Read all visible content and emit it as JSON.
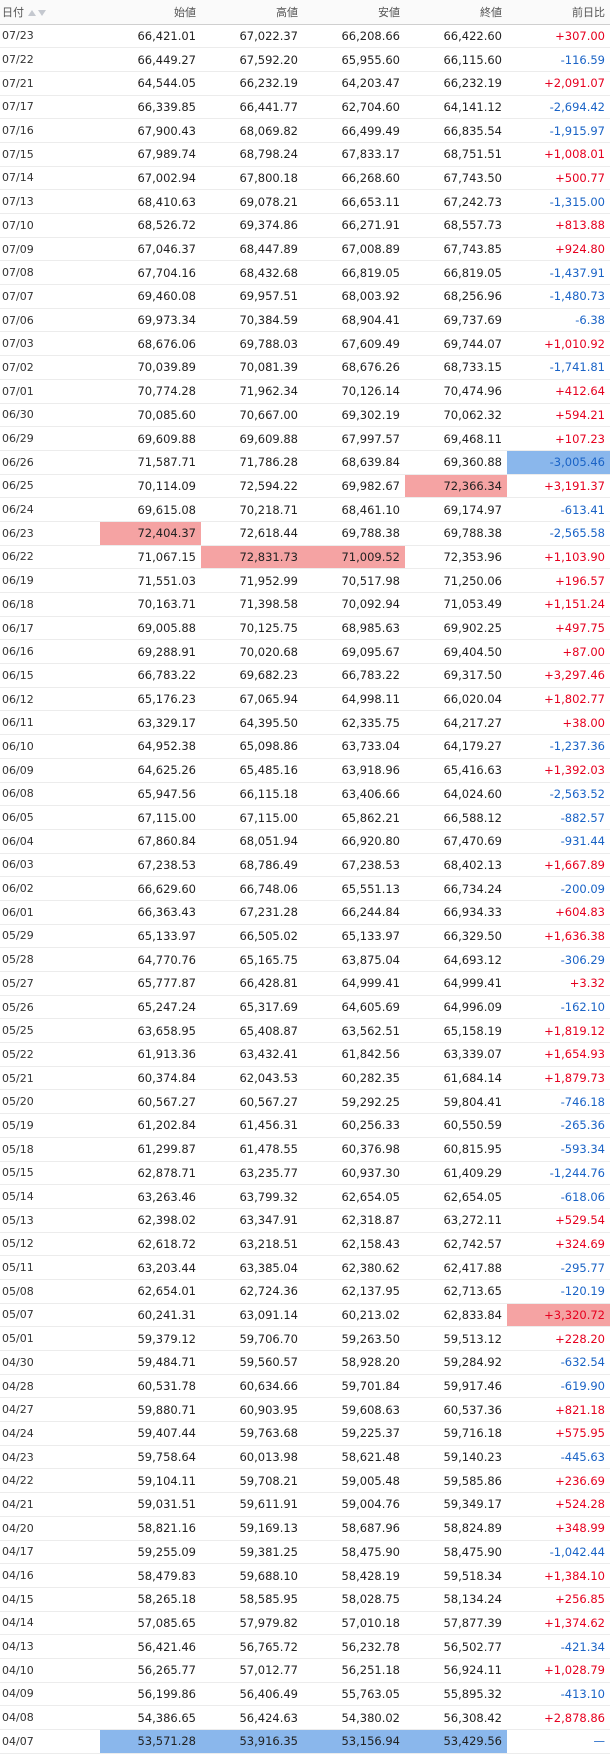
{
  "headers": {
    "date": "日付",
    "open": "始値",
    "high": "高値",
    "low": "安値",
    "close": "終値",
    "change": "前日比"
  },
  "colors": {
    "up": "#e6001f",
    "down": "#1a63c6",
    "highlight_high": "#f5a3a3",
    "highlight_low": "#8ab7ec"
  },
  "rows": [
    {
      "date": "07/23",
      "open": "66,421.01",
      "high": "67,022.37",
      "low": "66,208.66",
      "close": "66,422.60",
      "change": "+307.00"
    },
    {
      "date": "07/22",
      "open": "66,449.27",
      "high": "67,592.20",
      "low": "65,955.60",
      "close": "66,115.60",
      "change": "-116.59"
    },
    {
      "date": "07/21",
      "open": "64,544.05",
      "high": "66,232.19",
      "low": "64,203.47",
      "close": "66,232.19",
      "change": "+2,091.07"
    },
    {
      "date": "07/17",
      "open": "66,339.85",
      "high": "66,441.77",
      "low": "62,704.60",
      "close": "64,141.12",
      "change": "-2,694.42"
    },
    {
      "date": "07/16",
      "open": "67,900.43",
      "high": "68,069.82",
      "low": "66,499.49",
      "close": "66,835.54",
      "change": "-1,915.97"
    },
    {
      "date": "07/15",
      "open": "67,989.74",
      "high": "68,798.24",
      "low": "67,833.17",
      "close": "68,751.51",
      "change": "+1,008.01"
    },
    {
      "date": "07/14",
      "open": "67,002.94",
      "high": "67,800.18",
      "low": "66,268.60",
      "close": "67,743.50",
      "change": "+500.77"
    },
    {
      "date": "07/13",
      "open": "68,410.63",
      "high": "69,078.21",
      "low": "66,653.11",
      "close": "67,242.73",
      "change": "-1,315.00"
    },
    {
      "date": "07/10",
      "open": "68,526.72",
      "high": "69,374.86",
      "low": "66,271.91",
      "close": "68,557.73",
      "change": "+813.88"
    },
    {
      "date": "07/09",
      "open": "67,046.37",
      "high": "68,447.89",
      "low": "67,008.89",
      "close": "67,743.85",
      "change": "+924.80"
    },
    {
      "date": "07/08",
      "open": "67,704.16",
      "high": "68,432.68",
      "low": "66,819.05",
      "close": "66,819.05",
      "change": "-1,437.91"
    },
    {
      "date": "07/07",
      "open": "69,460.08",
      "high": "69,957.51",
      "low": "68,003.92",
      "close": "68,256.96",
      "change": "-1,480.73"
    },
    {
      "date": "07/06",
      "open": "69,973.34",
      "high": "70,384.59",
      "low": "68,904.41",
      "close": "69,737.69",
      "change": "-6.38"
    },
    {
      "date": "07/03",
      "open": "68,676.06",
      "high": "69,788.03",
      "low": "67,609.49",
      "close": "69,744.07",
      "change": "+1,010.92"
    },
    {
      "date": "07/02",
      "open": "70,039.89",
      "high": "70,081.39",
      "low": "68,676.26",
      "close": "68,733.15",
      "change": "-1,741.81"
    },
    {
      "date": "07/01",
      "open": "70,774.28",
      "high": "71,962.34",
      "low": "70,126.14",
      "close": "70,474.96",
      "change": "+412.64"
    },
    {
      "date": "06/30",
      "open": "70,085.60",
      "high": "70,667.00",
      "low": "69,302.19",
      "close": "70,062.32",
      "change": "+594.21"
    },
    {
      "date": "06/29",
      "open": "69,609.88",
      "high": "69,609.88",
      "low": "67,997.57",
      "close": "69,468.11",
      "change": "+107.23"
    },
    {
      "date": "06/26",
      "open": "71,587.71",
      "high": "71,786.28",
      "low": "68,639.84",
      "close": "69,360.88",
      "change": "-3,005.46",
      "hl": {
        "change": "lo"
      }
    },
    {
      "date": "06/25",
      "open": "70,114.09",
      "high": "72,594.22",
      "low": "69,982.67",
      "close": "72,366.34",
      "change": "+3,191.37",
      "hl": {
        "close": "hi"
      }
    },
    {
      "date": "06/24",
      "open": "69,615.08",
      "high": "70,218.71",
      "low": "68,461.10",
      "close": "69,174.97",
      "change": "-613.41"
    },
    {
      "date": "06/23",
      "open": "72,404.37",
      "high": "72,618.44",
      "low": "69,788.38",
      "close": "69,788.38",
      "change": "-2,565.58",
      "hl": {
        "open": "hi"
      }
    },
    {
      "date": "06/22",
      "open": "71,067.15",
      "high": "72,831.73",
      "low": "71,009.52",
      "close": "72,353.96",
      "change": "+1,103.90",
      "hl": {
        "high": "hi",
        "low": "hi"
      }
    },
    {
      "date": "06/19",
      "open": "71,551.03",
      "high": "71,952.99",
      "low": "70,517.98",
      "close": "71,250.06",
      "change": "+196.57"
    },
    {
      "date": "06/18",
      "open": "70,163.71",
      "high": "71,398.58",
      "low": "70,092.94",
      "close": "71,053.49",
      "change": "+1,151.24"
    },
    {
      "date": "06/17",
      "open": "69,005.88",
      "high": "70,125.75",
      "low": "68,985.63",
      "close": "69,902.25",
      "change": "+497.75"
    },
    {
      "date": "06/16",
      "open": "69,288.91",
      "high": "70,020.68",
      "low": "69,095.67",
      "close": "69,404.50",
      "change": "+87.00"
    },
    {
      "date": "06/15",
      "open": "66,783.22",
      "high": "69,682.23",
      "low": "66,783.22",
      "close": "69,317.50",
      "change": "+3,297.46"
    },
    {
      "date": "06/12",
      "open": "65,176.23",
      "high": "67,065.94",
      "low": "64,998.11",
      "close": "66,020.04",
      "change": "+1,802.77"
    },
    {
      "date": "06/11",
      "open": "63,329.17",
      "high": "64,395.50",
      "low": "62,335.75",
      "close": "64,217.27",
      "change": "+38.00"
    },
    {
      "date": "06/10",
      "open": "64,952.38",
      "high": "65,098.86",
      "low": "63,733.04",
      "close": "64,179.27",
      "change": "-1,237.36"
    },
    {
      "date": "06/09",
      "open": "64,625.26",
      "high": "65,485.16",
      "low": "63,918.96",
      "close": "65,416.63",
      "change": "+1,392.03"
    },
    {
      "date": "06/08",
      "open": "65,947.56",
      "high": "66,115.18",
      "low": "63,406.66",
      "close": "64,024.60",
      "change": "-2,563.52"
    },
    {
      "date": "06/05",
      "open": "67,115.00",
      "high": "67,115.00",
      "low": "65,862.21",
      "close": "66,588.12",
      "change": "-882.57"
    },
    {
      "date": "06/04",
      "open": "67,860.84",
      "high": "68,051.94",
      "low": "66,920.80",
      "close": "67,470.69",
      "change": "-931.44"
    },
    {
      "date": "06/03",
      "open": "67,238.53",
      "high": "68,786.49",
      "low": "67,238.53",
      "close": "68,402.13",
      "change": "+1,667.89"
    },
    {
      "date": "06/02",
      "open": "66,629.60",
      "high": "66,748.06",
      "low": "65,551.13",
      "close": "66,734.24",
      "change": "-200.09"
    },
    {
      "date": "06/01",
      "open": "66,363.43",
      "high": "67,231.28",
      "low": "66,244.84",
      "close": "66,934.33",
      "change": "+604.83"
    },
    {
      "date": "05/29",
      "open": "65,133.97",
      "high": "66,505.02",
      "low": "65,133.97",
      "close": "66,329.50",
      "change": "+1,636.38"
    },
    {
      "date": "05/28",
      "open": "64,770.76",
      "high": "65,165.75",
      "low": "63,875.04",
      "close": "64,693.12",
      "change": "-306.29"
    },
    {
      "date": "05/27",
      "open": "65,777.87",
      "high": "66,428.81",
      "low": "64,999.41",
      "close": "64,999.41",
      "change": "+3.32"
    },
    {
      "date": "05/26",
      "open": "65,247.24",
      "high": "65,317.69",
      "low": "64,605.69",
      "close": "64,996.09",
      "change": "-162.10"
    },
    {
      "date": "05/25",
      "open": "63,658.95",
      "high": "65,408.87",
      "low": "63,562.51",
      "close": "65,158.19",
      "change": "+1,819.12"
    },
    {
      "date": "05/22",
      "open": "61,913.36",
      "high": "63,432.41",
      "low": "61,842.56",
      "close": "63,339.07",
      "change": "+1,654.93"
    },
    {
      "date": "05/21",
      "open": "60,374.84",
      "high": "62,043.53",
      "low": "60,282.35",
      "close": "61,684.14",
      "change": "+1,879.73"
    },
    {
      "date": "05/20",
      "open": "60,567.27",
      "high": "60,567.27",
      "low": "59,292.25",
      "close": "59,804.41",
      "change": "-746.18"
    },
    {
      "date": "05/19",
      "open": "61,202.84",
      "high": "61,456.31",
      "low": "60,256.33",
      "close": "60,550.59",
      "change": "-265.36"
    },
    {
      "date": "05/18",
      "open": "61,299.87",
      "high": "61,478.55",
      "low": "60,376.98",
      "close": "60,815.95",
      "change": "-593.34"
    },
    {
      "date": "05/15",
      "open": "62,878.71",
      "high": "63,235.77",
      "low": "60,937.30",
      "close": "61,409.29",
      "change": "-1,244.76"
    },
    {
      "date": "05/14",
      "open": "63,263.46",
      "high": "63,799.32",
      "low": "62,654.05",
      "close": "62,654.05",
      "change": "-618.06"
    },
    {
      "date": "05/13",
      "open": "62,398.02",
      "high": "63,347.91",
      "low": "62,318.87",
      "close": "63,272.11",
      "change": "+529.54"
    },
    {
      "date": "05/12",
      "open": "62,618.72",
      "high": "63,218.51",
      "low": "62,158.43",
      "close": "62,742.57",
      "change": "+324.69"
    },
    {
      "date": "05/11",
      "open": "63,203.44",
      "high": "63,385.04",
      "low": "62,380.62",
      "close": "62,417.88",
      "change": "-295.77"
    },
    {
      "date": "05/08",
      "open": "62,654.01",
      "high": "62,724.36",
      "low": "62,137.95",
      "close": "62,713.65",
      "change": "-120.19"
    },
    {
      "date": "05/07",
      "open": "60,241.31",
      "high": "63,091.14",
      "low": "60,213.02",
      "close": "62,833.84",
      "change": "+3,320.72",
      "hl": {
        "change": "hi"
      }
    },
    {
      "date": "05/01",
      "open": "59,379.12",
      "high": "59,706.70",
      "low": "59,263.50",
      "close": "59,513.12",
      "change": "+228.20"
    },
    {
      "date": "04/30",
      "open": "59,484.71",
      "high": "59,560.57",
      "low": "58,928.20",
      "close": "59,284.92",
      "change": "-632.54"
    },
    {
      "date": "04/28",
      "open": "60,531.78",
      "high": "60,634.66",
      "low": "59,701.84",
      "close": "59,917.46",
      "change": "-619.90"
    },
    {
      "date": "04/27",
      "open": "59,880.71",
      "high": "60,903.95",
      "low": "59,608.63",
      "close": "60,537.36",
      "change": "+821.18"
    },
    {
      "date": "04/24",
      "open": "59,407.44",
      "high": "59,763.68",
      "low": "59,225.37",
      "close": "59,716.18",
      "change": "+575.95"
    },
    {
      "date": "04/23",
      "open": "59,758.64",
      "high": "60,013.98",
      "low": "58,621.48",
      "close": "59,140.23",
      "change": "-445.63"
    },
    {
      "date": "04/22",
      "open": "59,104.11",
      "high": "59,708.21",
      "low": "59,005.48",
      "close": "59,585.86",
      "change": "+236.69"
    },
    {
      "date": "04/21",
      "open": "59,031.51",
      "high": "59,611.91",
      "low": "59,004.76",
      "close": "59,349.17",
      "change": "+524.28"
    },
    {
      "date": "04/20",
      "open": "58,821.16",
      "high": "59,169.13",
      "low": "58,687.96",
      "close": "58,824.89",
      "change": "+348.99"
    },
    {
      "date": "04/17",
      "open": "59,255.09",
      "high": "59,381.25",
      "low": "58,475.90",
      "close": "58,475.90",
      "change": "-1,042.44"
    },
    {
      "date": "04/16",
      "open": "58,479.83",
      "high": "59,688.10",
      "low": "58,428.19",
      "close": "59,518.34",
      "change": "+1,384.10"
    },
    {
      "date": "04/15",
      "open": "58,265.18",
      "high": "58,585.95",
      "low": "58,028.75",
      "close": "58,134.24",
      "change": "+256.85"
    },
    {
      "date": "04/14",
      "open": "57,085.65",
      "high": "57,979.82",
      "low": "57,010.18",
      "close": "57,877.39",
      "change": "+1,374.62"
    },
    {
      "date": "04/13",
      "open": "56,421.46",
      "high": "56,765.72",
      "low": "56,232.78",
      "close": "56,502.77",
      "change": "-421.34"
    },
    {
      "date": "04/10",
      "open": "56,265.77",
      "high": "57,012.77",
      "low": "56,251.18",
      "close": "56,924.11",
      "change": "+1,028.79"
    },
    {
      "date": "04/09",
      "open": "56,199.86",
      "high": "56,406.49",
      "low": "55,763.05",
      "close": "55,895.32",
      "change": "-413.10"
    },
    {
      "date": "04/08",
      "open": "54,386.65",
      "high": "56,424.63",
      "low": "54,380.02",
      "close": "56,308.42",
      "change": "+2,878.86"
    },
    {
      "date": "04/07",
      "open": "53,571.28",
      "high": "53,916.35",
      "low": "53,156.94",
      "close": "53,429.56",
      "change": "—",
      "hl": {
        "open": "lo",
        "high": "lo",
        "low": "lo",
        "close": "lo"
      }
    }
  ]
}
